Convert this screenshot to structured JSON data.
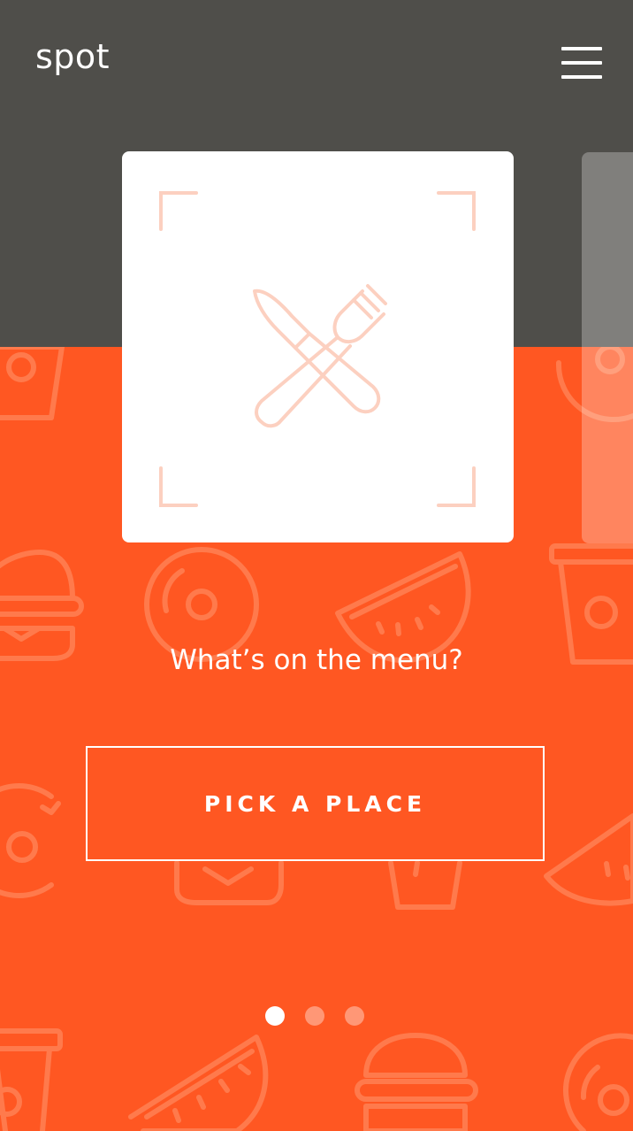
{
  "app": {
    "logo": "spot"
  },
  "header": {
    "menu_icon": "hamburger-menu-icon"
  },
  "carousel": {
    "active_index": 0,
    "total": 3,
    "card_icon": "fork-knife-icon",
    "prompt": "What’s on the menu?",
    "cta_label": "PICK A PLACE"
  },
  "colors": {
    "header_bg": "#4F4E4A",
    "accent": "#FF5722",
    "icon_tint": "#FCD0C0",
    "pattern_stroke": "#FF7A4C"
  }
}
